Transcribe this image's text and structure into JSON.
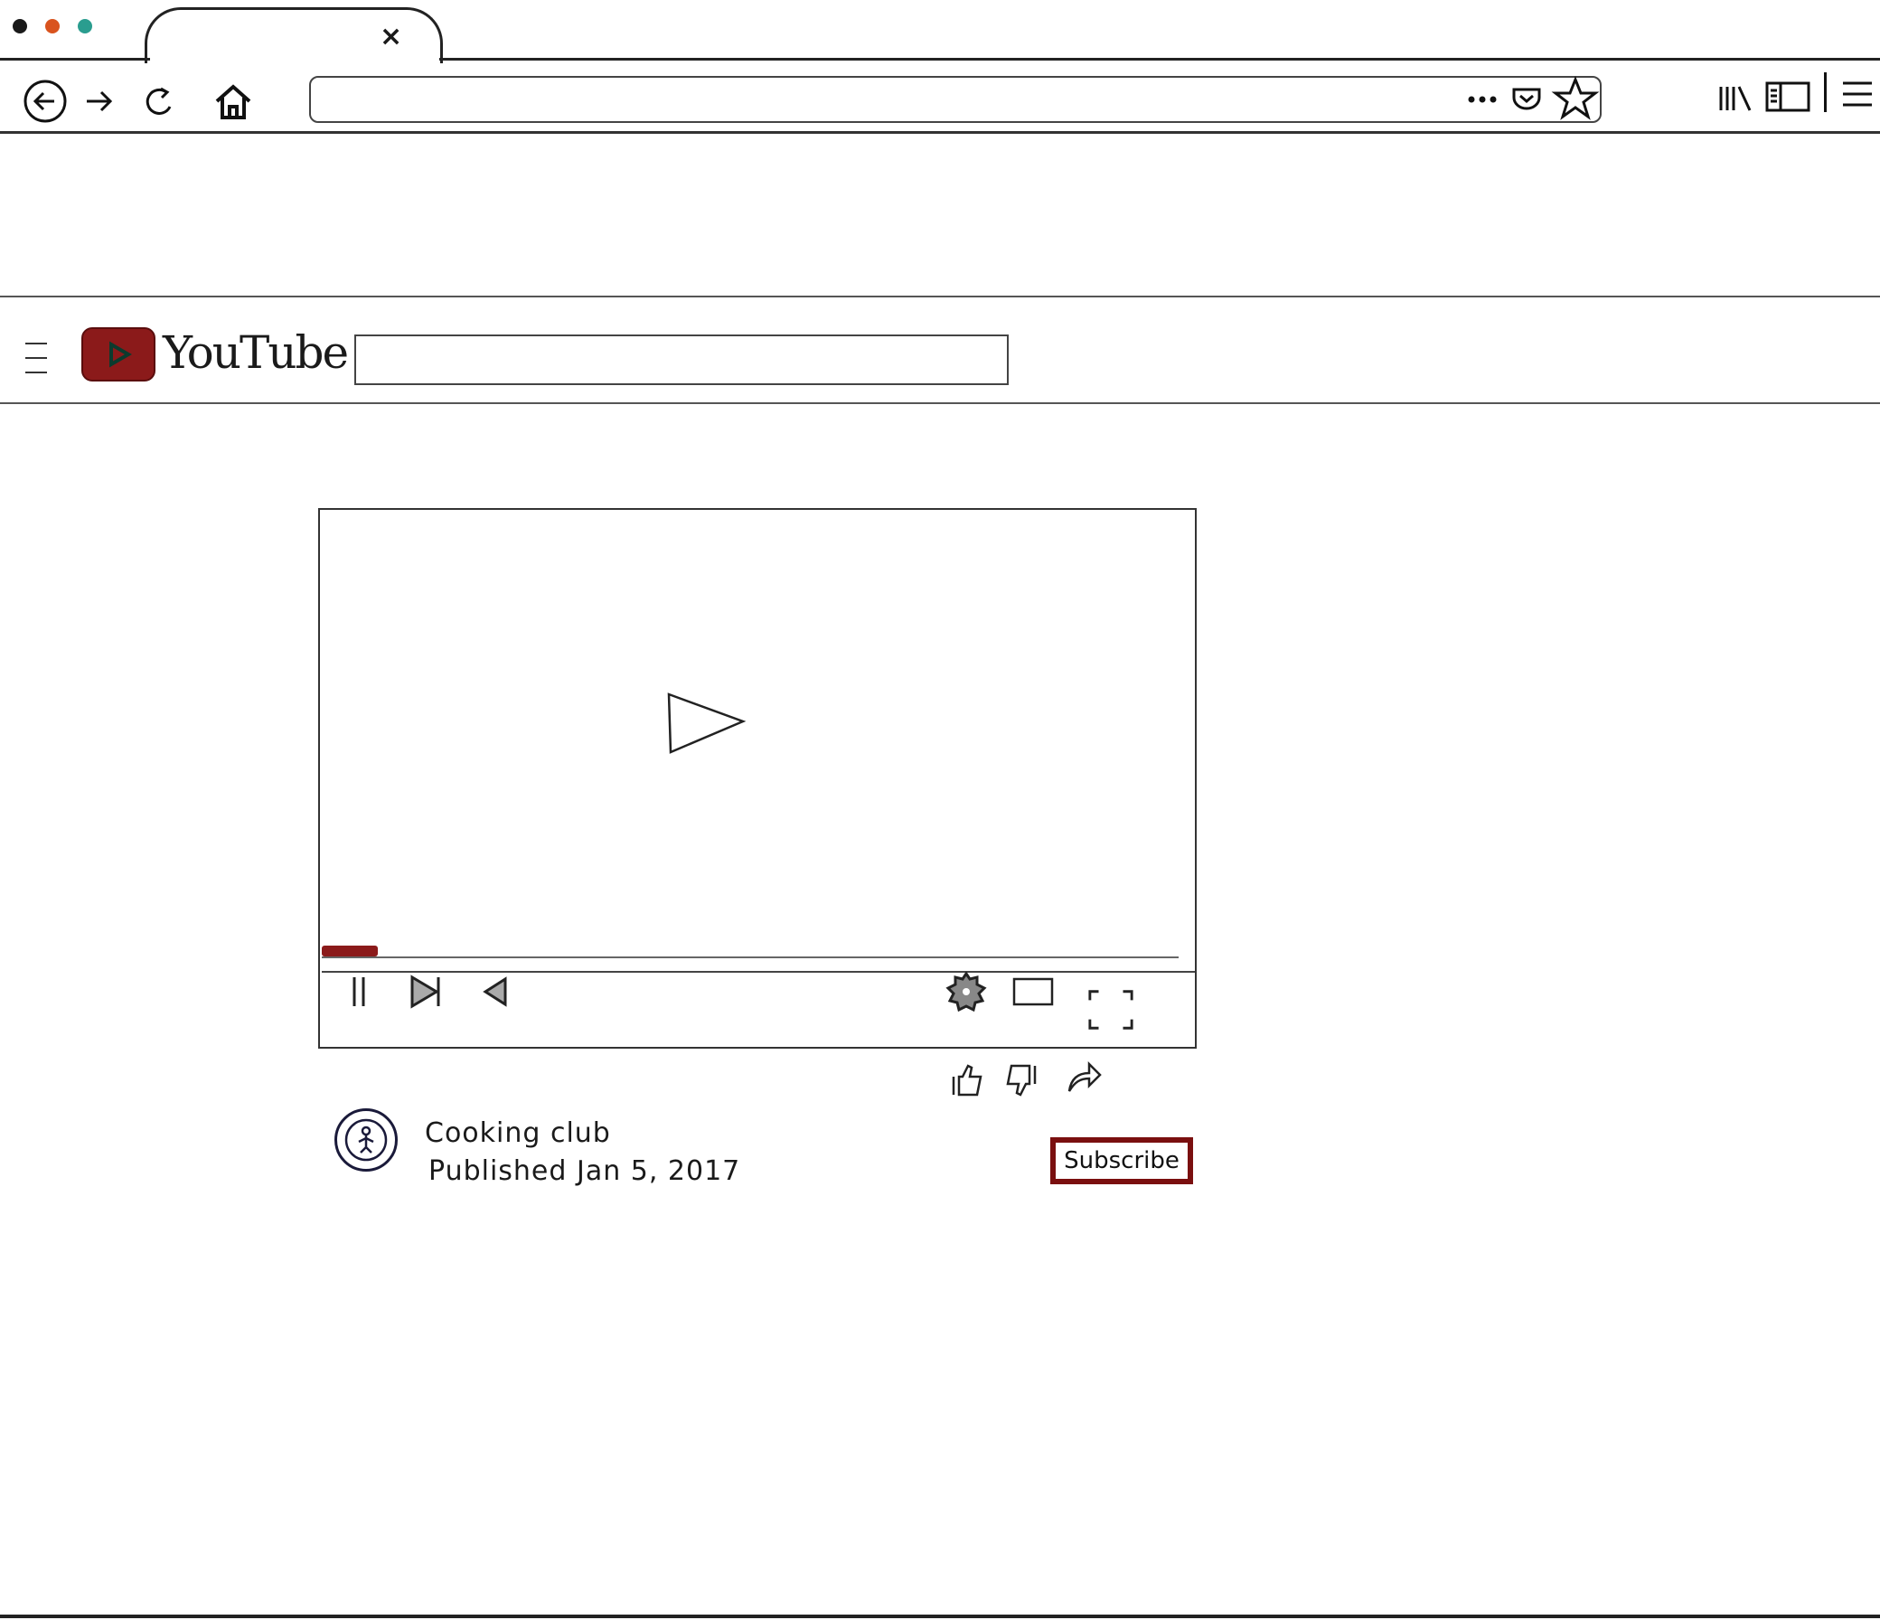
{
  "browser": {
    "tab_close_label": "×",
    "dots": [
      {
        "name": "close-dot",
        "color": "#1a1a1a"
      },
      {
        "name": "minimize-dot",
        "color": "#d9531e"
      },
      {
        "name": "maximize-dot",
        "color": "#2a9d8f"
      }
    ],
    "url_value": ""
  },
  "youtube": {
    "wordmark": "YouTube",
    "brand_color": "#8b1a1a",
    "search_value": ""
  },
  "player": {
    "progress_fraction": 0.065
  },
  "video": {
    "channel_name": "Cooking club",
    "published": "Published  Jan 5, 2017",
    "subscribe_label": "Subscribe"
  }
}
